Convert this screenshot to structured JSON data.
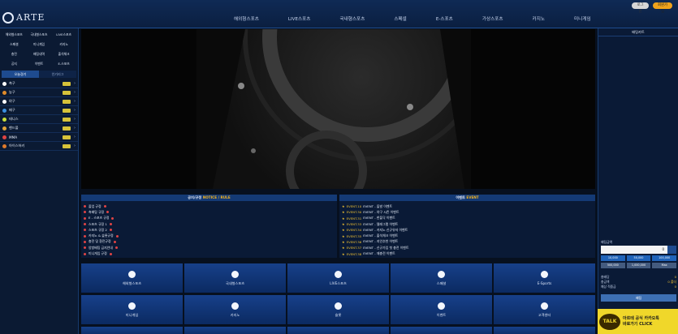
{
  "header": {
    "logo_text": "ARTE",
    "nav": [
      "해외형스포츠",
      "LIVE스포츠",
      "국내형스포츠",
      "스페셜",
      "E-스포츠",
      "가상스포츠",
      "카지노",
      "미니게임"
    ],
    "login_label": "로그인",
    "join_label": "회원가입"
  },
  "sidebar": {
    "grid": [
      "해외형스포츠",
      "국내형스포츠",
      "LIVE스포츠",
      "스페셜",
      "미니게임",
      "카지노",
      "충전",
      "배팅내역",
      "출석체크",
      "공지",
      "이벤트",
      "E-스포츠"
    ],
    "tabs": [
      "오늘경기",
      "인기리그"
    ],
    "sports": [
      {
        "label": "축구",
        "color": "#ffffff"
      },
      {
        "label": "농구",
        "color": "#e08b2a"
      },
      {
        "label": "야구",
        "color": "#ffffff"
      },
      {
        "label": "배구",
        "color": "#3b8fe0"
      },
      {
        "label": "테니스",
        "color": "#c9e03a"
      },
      {
        "label": "핸드볼",
        "color": "#e0a43a"
      },
      {
        "label": "MMA",
        "color": "#e04444"
      },
      {
        "label": "아이스하키",
        "color": "#e07a2a"
      }
    ]
  },
  "notice": {
    "title_main": "공지/규정",
    "title_accent": "NOTICE / RULE",
    "items": [
      "졸업 규정",
      "축배팅 규정",
      "E - 스포츠 규정",
      "스포츠 규정 1",
      "스포츠 규정 2",
      "카지노 & 슬롯규정",
      "충전 및 환전규정",
      "양방배팅 금지안내",
      "미니게임 규정"
    ]
  },
  "events": {
    "title_main": "이벤트",
    "title_accent": "EVENT",
    "items": [
      {
        "code": "EVENT.10",
        "text": "EVENT - 돌발 이벤트"
      },
      {
        "code": "EVENT.30",
        "text": "EVENT - 야구 시즌 이벤트"
      },
      {
        "code": "EVENT.31",
        "text": "EVENT - 한돌닥 이벤트"
      },
      {
        "code": "EVENT.33",
        "text": "EVENT - 텔레그램 이벤트"
      },
      {
        "code": "EVENT.34",
        "text": "EVENT - 카지노 신규유저 이벤트"
      },
      {
        "code": "EVENT.35",
        "text": "EVENT - 출석체크 이벤트"
      },
      {
        "code": "EVENT.36",
        "text": "EVENT - 지인추천 이벤트"
      },
      {
        "code": "EVENT.37",
        "text": "EVENT - 신규가입 첫 충전 이벤트"
      },
      {
        "code": "EVENT.38",
        "text": "EVENT - 재충전 이벤트"
      }
    ]
  },
  "tiles": [
    "해외형스포츠",
    "국내형스포츠",
    "LIVE스포츠",
    "스페셜",
    "E-Sports",
    "미니게임",
    "카지노",
    "슬롯",
    "이벤트",
    "고객센터",
    "",
    "",
    "",
    "",
    ""
  ],
  "cart": {
    "title": "배팅카트",
    "label_amount": "배팅금액",
    "amount": "0",
    "chips": [
      "10,000",
      "50,000",
      "100,000",
      "500,000",
      "1,000,000",
      "Max"
    ],
    "rows": [
      {
        "k": "총배당",
        "v": "0"
      },
      {
        "k": "총금액",
        "v": "0 폴더"
      },
      {
        "k": "예상 적중금",
        "v": "0"
      }
    ],
    "bet_label": "배팅"
  },
  "talk": {
    "bubble": "TALK",
    "line1": "아르테 공식 카카오톡",
    "line2": "바로가기 CLICK"
  }
}
